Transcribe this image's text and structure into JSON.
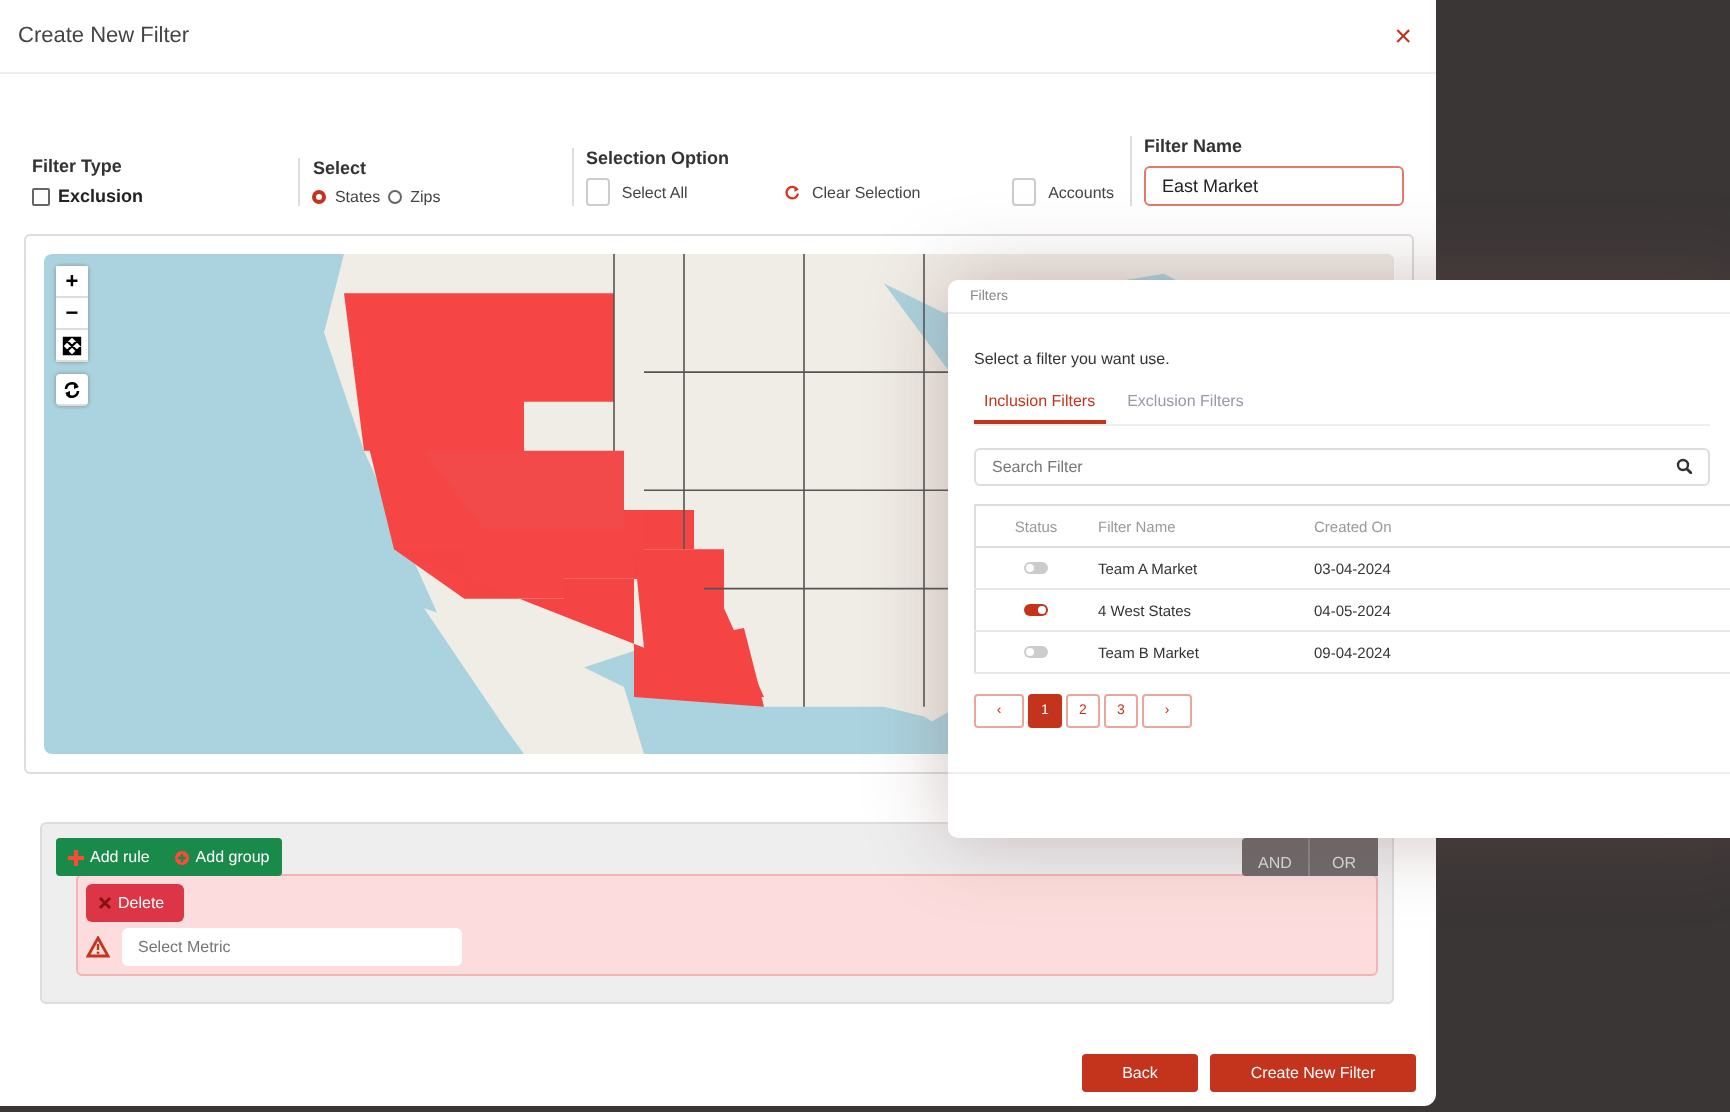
{
  "dialog": {
    "title": "Create New Filter",
    "close": "×"
  },
  "filter_type": {
    "label": "Filter Type",
    "option": {
      "label": "Exclusion",
      "checked": false
    }
  },
  "select": {
    "label": "Select",
    "options": [
      {
        "label": "States",
        "selected": true
      },
      {
        "label": "Zips",
        "selected": false
      }
    ]
  },
  "selection_option": {
    "label": "Selection Option",
    "select_all": {
      "label": "Select All",
      "checked": false
    },
    "clear": "Clear Selection",
    "accounts": {
      "label": "Accounts",
      "checked": false
    }
  },
  "filter_name": {
    "label": "Filter Name",
    "value": "East Market"
  },
  "map_controls": [
    "+",
    "−"
  ],
  "query_builder": {
    "buttons": [
      "Add rule",
      "Add group"
    ],
    "conditions": [
      {
        "label": "AND",
        "selected": false
      },
      {
        "label": "OR",
        "selected": false
      }
    ],
    "delete": "Delete",
    "metric_placeholder": "Select Metric"
  },
  "footer_buttons": [
    "Back",
    "Create New Filter"
  ],
  "filters_popup": {
    "title": "Filters",
    "prompt": "Select a filter you want use.",
    "tabs": [
      {
        "label": "Inclusion Filters",
        "selected": true
      },
      {
        "label": "Exclusion Filters",
        "selected": false
      }
    ],
    "search_placeholder": "Search Filter",
    "columns": [
      "Status",
      "Filter Name",
      "Created On"
    ],
    "rows": [
      {
        "on": false,
        "name": "Team A Market",
        "created": "03-04-2024"
      },
      {
        "on": true,
        "name": "4 West States",
        "created": "04-05-2024"
      },
      {
        "on": false,
        "name": "Team B Market",
        "created": "09-04-2024"
      }
    ],
    "pager": {
      "prev": "‹",
      "next": "›",
      "pages": [
        {
          "label": "1",
          "selected": true
        },
        {
          "label": "2",
          "selected": false
        },
        {
          "label": "3",
          "selected": false
        }
      ]
    }
  }
}
